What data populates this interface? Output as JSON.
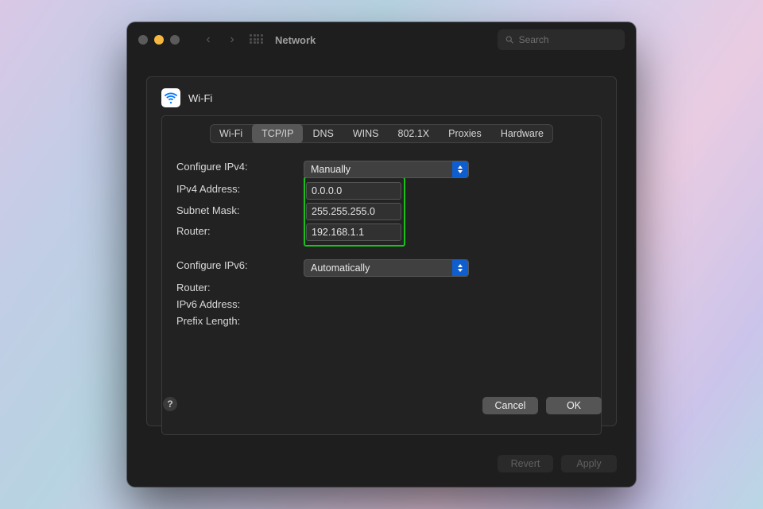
{
  "window": {
    "title": "Network",
    "search_placeholder": "Search"
  },
  "panel": {
    "title": "Wi-Fi",
    "help_symbol": "?",
    "tabs": [
      {
        "label": "Wi-Fi",
        "active": false
      },
      {
        "label": "TCP/IP",
        "active": true
      },
      {
        "label": "DNS",
        "active": false
      },
      {
        "label": "WINS",
        "active": false
      },
      {
        "label": "802.1X",
        "active": false
      },
      {
        "label": "Proxies",
        "active": false
      },
      {
        "label": "Hardware",
        "active": false
      }
    ]
  },
  "form": {
    "configure_ipv4_label": "Configure IPv4:",
    "configure_ipv4_value": "Manually",
    "ipv4_address_label": "IPv4 Address:",
    "ipv4_address_value": "0.0.0.0",
    "subnet_mask_label": "Subnet Mask:",
    "subnet_mask_value": "255.255.255.0",
    "router_v4_label": "Router:",
    "router_v4_value": "192.168.1.1",
    "configure_ipv6_label": "Configure IPv6:",
    "configure_ipv6_value": "Automatically",
    "router_v6_label": "Router:",
    "ipv6_address_label": "IPv6 Address:",
    "prefix_length_label": "Prefix Length:"
  },
  "buttons": {
    "cancel": "Cancel",
    "ok": "OK",
    "revert": "Revert",
    "apply": "Apply"
  },
  "colors": {
    "highlight": "#18c218",
    "accent": "#0f5ecf"
  }
}
